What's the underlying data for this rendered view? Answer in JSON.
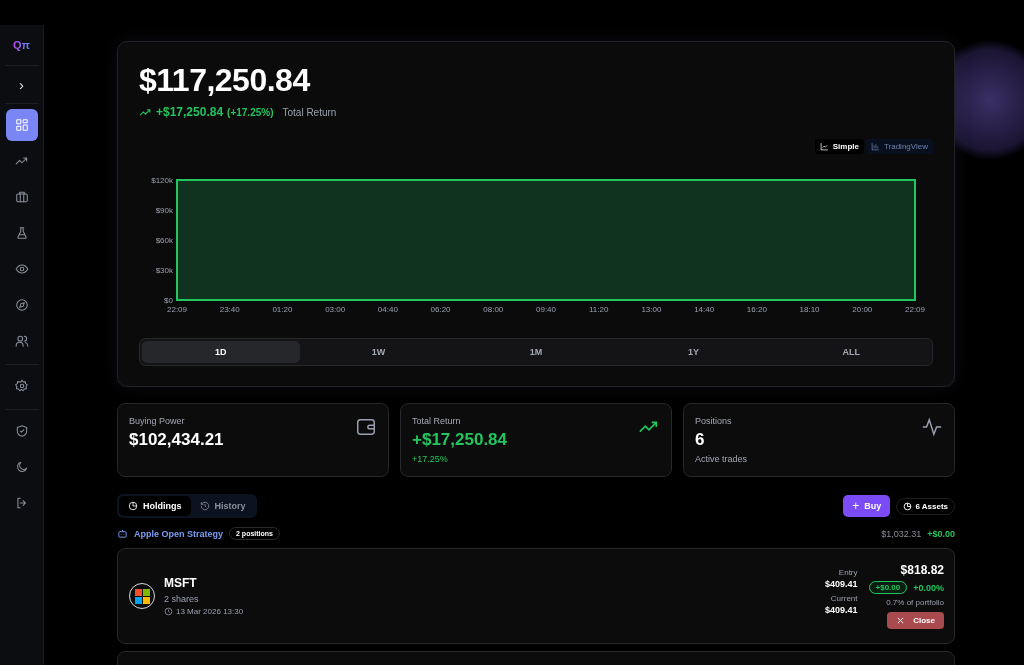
{
  "sidebar": {
    "logo": "Qπ",
    "expand_icon": "›",
    "items": [
      {
        "kind": "grid",
        "selected": true
      },
      {
        "kind": "trend",
        "selected": false
      },
      {
        "kind": "briefcase",
        "selected": false
      },
      {
        "kind": "flask",
        "selected": false
      },
      {
        "kind": "eye",
        "selected": false
      },
      {
        "kind": "compass",
        "selected": false
      },
      {
        "kind": "users",
        "selected": false
      },
      {
        "kind": "gear",
        "selected": false
      },
      {
        "kind": "shield",
        "selected": false
      },
      {
        "kind": "moon",
        "selected": false
      },
      {
        "kind": "logout",
        "selected": false
      }
    ]
  },
  "portfolio": {
    "value": "$117,250.84",
    "change": "+$17,250.84",
    "change_pct": "(+17.25%)",
    "change_label": "Total Return",
    "chart_modes": [
      {
        "label": "Simple",
        "selected": true
      },
      {
        "label": "TradingView",
        "selected": false
      }
    ],
    "chart_data": {
      "type": "area",
      "categories": [
        "22:09",
        "23:40",
        "01:20",
        "03:00",
        "04:40",
        "06:20",
        "08:00",
        "09:40",
        "11:20",
        "13:00",
        "14:40",
        "16:20",
        "18:10",
        "20:00",
        "22:09"
      ],
      "series": [
        {
          "color": "#22c55e",
          "values": [
            120000,
            120000,
            120000,
            120000,
            120000,
            120000,
            120000,
            120000,
            120000,
            120000,
            120000,
            120000,
            120000,
            120000,
            120000
          ]
        }
      ],
      "ylim": [
        0,
        120000
      ],
      "yticks": [
        {
          "value": 0,
          "label": "$0"
        },
        {
          "value": 30000,
          "label": "$30k"
        },
        {
          "value": 60000,
          "label": "$60k"
        },
        {
          "value": 90000,
          "label": "$90k"
        },
        {
          "value": 120000,
          "label": "$120k"
        }
      ]
    },
    "ranges": [
      {
        "label": "1D",
        "selected": true
      },
      {
        "label": "1W",
        "selected": false
      },
      {
        "label": "1M",
        "selected": false
      },
      {
        "label": "1Y",
        "selected": false
      },
      {
        "label": "ALL",
        "selected": false
      }
    ]
  },
  "stats": [
    {
      "kind": "wallet",
      "label": "Buying Power",
      "value": "$102,434.21",
      "positive": false
    },
    {
      "kind": "trend",
      "label": "Total Return",
      "value": "+$17,250.84",
      "sub": "+17.25%",
      "positive": true
    },
    {
      "kind": "pulse",
      "label": "Positions",
      "value": "6",
      "sub": "Active trades",
      "positive": false
    }
  ],
  "view_tabs": [
    {
      "label": "Holdings",
      "selected": true
    },
    {
      "label": "History",
      "selected": false
    }
  ],
  "buy_button": {
    "icon": "+",
    "label": "Buy"
  },
  "assets_badge": "6 Assets",
  "strategy": {
    "name": "Apple Open Strategy",
    "badge": "2 positions",
    "total": "$1,032.31",
    "pnl": "+$0.00"
  },
  "positions": [
    {
      "symbol": "MSFT",
      "shares": "2 shares",
      "date": "13 Mar 2026 13:30",
      "entry_label": "Entry",
      "entry": "$409.41",
      "current_label": "Current",
      "current": "$409.41",
      "value": "$818.82",
      "pnl": "+$0.00",
      "pnl_pct": "+0.00%",
      "portfolio_share": "0.7% of portfolio",
      "close": "Close"
    }
  ]
}
